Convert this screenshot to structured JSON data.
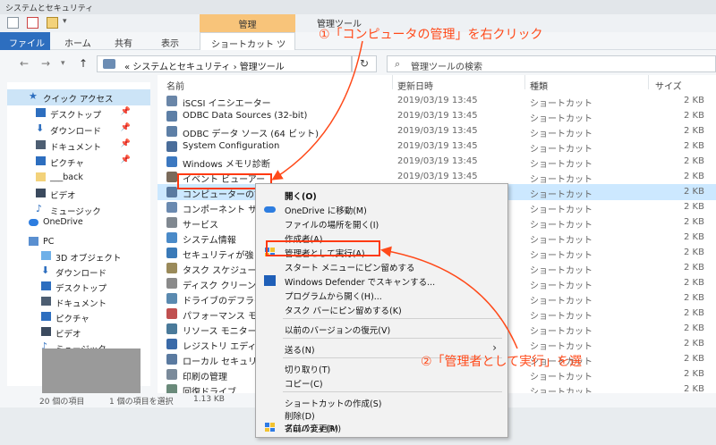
{
  "window": {
    "title": "システムとセキュリティ",
    "app_title": "管理ツール",
    "context_tab_header": "管理"
  },
  "ribbon": {
    "tabs": [
      "ファイル",
      "ホーム",
      "共有",
      "表示"
    ],
    "active_tab": "ショートカット ツール"
  },
  "address": {
    "path": "« システムとセキュリティ › 管理ツール",
    "refresh": "↻",
    "search_placeholder": "管理ツールの検索"
  },
  "nav_pane": {
    "items": [
      {
        "label": "クイック アクセス",
        "icon": "star-icon",
        "pinned": false
      },
      {
        "label": "デスクトップ",
        "icon": "desktop-icon",
        "pinned": true
      },
      {
        "label": "ダウンロード",
        "icon": "download-icon",
        "pinned": true
      },
      {
        "label": "ドキュメント",
        "icon": "documents-icon",
        "pinned": true
      },
      {
        "label": "ピクチャ",
        "icon": "pictures-icon",
        "pinned": true
      },
      {
        "label": "___back",
        "icon": "folder-icon",
        "pinned": false
      },
      {
        "label": "ビデオ",
        "icon": "video-icon",
        "pinned": false
      },
      {
        "label": "ミュージック",
        "icon": "music-icon",
        "pinned": false
      },
      {
        "label": "OneDrive",
        "icon": "cloud-icon",
        "pinned": false
      },
      {
        "label": "PC",
        "icon": "pc-icon",
        "pinned": false
      },
      {
        "label": "3D オブジェクト",
        "icon": "3d-objects-icon",
        "pinned": false
      },
      {
        "label": "ダウンロード",
        "icon": "download-icon",
        "pinned": false
      },
      {
        "label": "デスクトップ",
        "icon": "desktop-icon",
        "pinned": false
      },
      {
        "label": "ドキュメント",
        "icon": "documents-icon",
        "pinned": false
      },
      {
        "label": "ピクチャ",
        "icon": "pictures-icon",
        "pinned": false
      },
      {
        "label": "ビデオ",
        "icon": "video-icon",
        "pinned": false
      },
      {
        "label": "ミュージック",
        "icon": "music-icon",
        "pinned": false
      }
    ]
  },
  "file_list": {
    "columns": {
      "name": "名前",
      "date": "更新日時",
      "type": "種類",
      "size": "サイズ"
    },
    "rows": [
      {
        "name": "iSCSI イニシエーター",
        "date": "2019/03/19 13:45",
        "type": "ショートカット",
        "size": "2 KB"
      },
      {
        "name": "ODBC Data Sources (32-bit)",
        "date": "2019/03/19 13:45",
        "type": "ショートカット",
        "size": "2 KB"
      },
      {
        "name": "ODBC データ ソース (64 ビット)",
        "date": "2019/03/19 13:45",
        "type": "ショートカット",
        "size": "2 KB"
      },
      {
        "name": "System Configuration",
        "date": "2019/03/19 13:45",
        "type": "ショートカット",
        "size": "2 KB"
      },
      {
        "name": "Windows メモリ診断",
        "date": "2019/03/19 13:45",
        "type": "ショートカット",
        "size": "2 KB"
      },
      {
        "name": "イベント ビューアー",
        "date": "2019/03/19 13:45",
        "type": "ショートカット",
        "size": "2 KB"
      },
      {
        "name": "コンピューターの管理",
        "date": "2019/03/19 13:45",
        "type": "ショートカット",
        "size": "2 KB",
        "selected": true
      },
      {
        "name": "コンポーネント サービス",
        "date": "",
        "type": "ショートカット",
        "size": "2 KB"
      },
      {
        "name": "サービス",
        "date": "",
        "type": "ショートカット",
        "size": "2 KB"
      },
      {
        "name": "システム情報",
        "date": "",
        "type": "ショートカット",
        "size": "2 KB"
      },
      {
        "name": "セキュリティが強",
        "date": "",
        "type": "ショートカット",
        "size": "2 KB"
      },
      {
        "name": "タスク スケジュー",
        "date": "",
        "type": "ショートカット",
        "size": "2 KB"
      },
      {
        "name": "ディスク クリーン",
        "date": "",
        "type": "ショートカット",
        "size": "2 KB"
      },
      {
        "name": "ドライブのデフラグ",
        "date": "",
        "type": "ショートカット",
        "size": "2 KB"
      },
      {
        "name": "パフォーマンス モ",
        "date": "",
        "type": "ショートカット",
        "size": "2 KB"
      },
      {
        "name": "リソース モニター",
        "date": "",
        "type": "ショートカット",
        "size": "2 KB"
      },
      {
        "name": "レジストリ エディ",
        "date": "",
        "type": "ショートカット",
        "size": "2 KB"
      },
      {
        "name": "ローカル セキュリ",
        "date": "",
        "type": "ショートカット",
        "size": "2 KB"
      },
      {
        "name": "印刷の管理",
        "date": "",
        "type": "ショートカット",
        "size": "2 KB"
      },
      {
        "name": "回復ドライブ",
        "date": "",
        "type": "ショートカット",
        "size": "2 KB"
      }
    ]
  },
  "status_bar": {
    "item_count": "20 個の項目",
    "selection": "1 個の項目を選択",
    "size": "1.13 KB"
  },
  "context_menu": {
    "items": [
      {
        "label": "開く(O)",
        "icon": ""
      },
      {
        "label": "OneDrive に移動(M)",
        "icon": "onedrive-icon"
      },
      {
        "label": "ファイルの場所を開く(I)",
        "icon": ""
      },
      {
        "label": "作成者(A)",
        "icon": ""
      },
      {
        "label": "管理者として実行(A)",
        "icon": "shield-icon"
      },
      {
        "label": "スタート メニューにピン留めする",
        "icon": ""
      },
      {
        "label": "Windows Defender でスキャンする...",
        "icon": "defender-icon"
      },
      {
        "label": "プログラムから開く(H)...",
        "icon": ""
      },
      {
        "label": "タスク バーにピン留めする(K)",
        "icon": ""
      },
      {
        "label": "以前のバージョンの復元(V)",
        "icon": ""
      },
      {
        "label": "送る(N)",
        "icon": "",
        "submenu": true
      },
      {
        "label": "切り取り(T)",
        "icon": ""
      },
      {
        "label": "コピー(C)",
        "icon": ""
      },
      {
        "label": "ショートカットの作成(S)",
        "icon": ""
      },
      {
        "label": "削除(D)",
        "icon": ""
      },
      {
        "label": "名前の変更(M)",
        "icon": "shield-icon"
      },
      {
        "label": "プロパティ(R)",
        "icon": ""
      }
    ]
  },
  "annotations": {
    "step1": "①「コンピュータの管理」を右クリック",
    "step2": "②「管理者として実行」を選",
    "color": "#ff4a1a"
  }
}
